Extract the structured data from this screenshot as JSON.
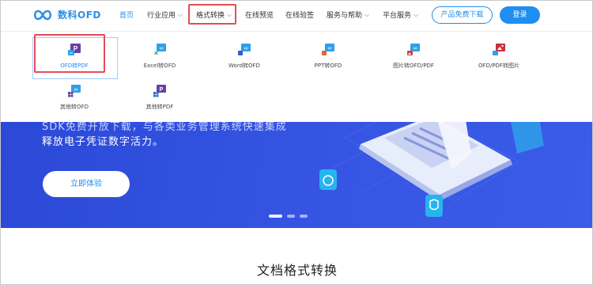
{
  "brand": {
    "name": "数科OFD"
  },
  "nav": {
    "items": [
      {
        "label": "首页",
        "active": true
      },
      {
        "label": "行业应用",
        "has_dropdown": true
      },
      {
        "label": "格式转换",
        "has_dropdown": true,
        "open": true
      },
      {
        "label": "在线预览"
      },
      {
        "label": "在线验签"
      },
      {
        "label": "服务与帮助",
        "has_dropdown": true
      },
      {
        "label": "平台服务",
        "has_dropdown": true
      }
    ],
    "download_label": "产品免费下载",
    "login_label": "登录"
  },
  "format_menu": {
    "items": [
      {
        "label": "OFD转PDF",
        "icon": "ofd-to-pdf-icon",
        "selected": true
      },
      {
        "label": "Excel转OFD",
        "icon": "excel-to-ofd-icon"
      },
      {
        "label": "Word转OFD",
        "icon": "word-to-ofd-icon"
      },
      {
        "label": "PPT转OFD",
        "icon": "ppt-to-ofd-icon"
      },
      {
        "label": "图片转OFD/PDF",
        "icon": "image-to-ofd-pdf-icon"
      },
      {
        "label": "OFD/PDF转图片",
        "icon": "ofd-pdf-to-image-icon"
      },
      {
        "label": "其他转OFD",
        "icon": "other-to-ofd-icon"
      },
      {
        "label": "其他转PDF",
        "icon": "other-to-pdf-icon"
      }
    ]
  },
  "hero": {
    "line1": "SDK免费开放下载，与各类业务管理系统快速集成",
    "line2": "释放电子凭证数字活力。",
    "cta_label": "立即体验",
    "slides": 3,
    "active_slide": 1
  },
  "section": {
    "title": "文档格式转换"
  },
  "colors": {
    "accent": "#1f8ef1",
    "highlight": "#e34d59",
    "hero_bg": "#3553e2",
    "pdf_purple": "#6b3fa8",
    "image_red": "#d64045"
  }
}
